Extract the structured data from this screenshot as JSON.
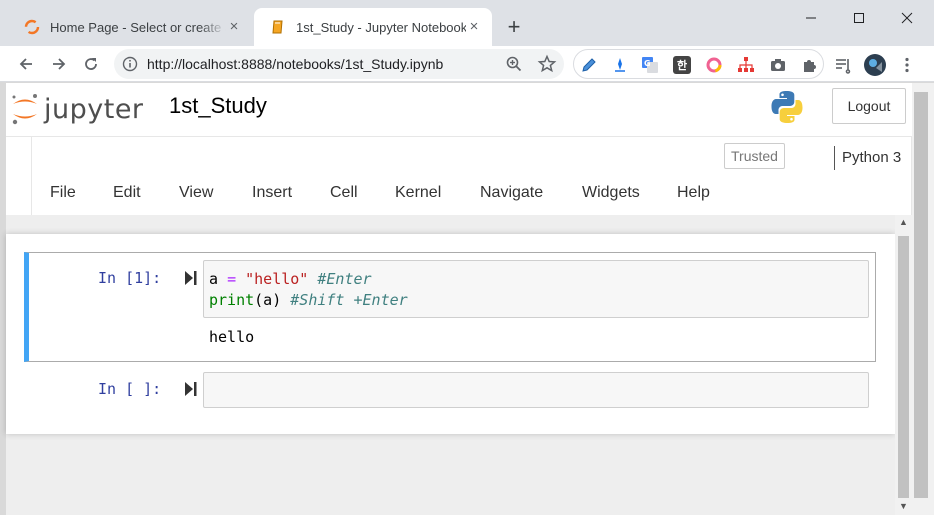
{
  "browser": {
    "tabs": [
      {
        "title": "Home Page - Select or create a notebook",
        "active": false,
        "favicon": "jupyter-icon"
      },
      {
        "title": "1st_Study - Jupyter Notebook",
        "active": true,
        "favicon": "notebook-icon"
      }
    ],
    "close_glyph": "×",
    "new_tab_glyph": "+",
    "url": "http://localhost:8888/notebooks/1st_Study.ipynb",
    "extensions": [
      "pen-icon",
      "pin-icon",
      "translate-icon",
      "hangul-icon",
      "circle-icon",
      "sitemap-icon",
      "camera-icon",
      "puzzle-icon"
    ],
    "hangul_glyph": "한"
  },
  "jupyter": {
    "logo_text": "jupyter",
    "notebook_title": "1st_Study",
    "logout_label": "Logout",
    "trusted_label": "Trusted",
    "kernel_name": "Python 3",
    "menu": [
      "File",
      "Edit",
      "View",
      "Insert",
      "Cell",
      "Kernel",
      "Navigate",
      "Widgets",
      "Help"
    ]
  },
  "cells": [
    {
      "prompt": "In [1]:",
      "code_lines": [
        [
          {
            "t": "a ",
            "c": ""
          },
          {
            "t": "=",
            "c": "op"
          },
          {
            "t": " ",
            "c": ""
          },
          {
            "t": "\"hello\"",
            "c": "str"
          },
          {
            "t": " ",
            "c": ""
          },
          {
            "t": "#Enter",
            "c": "cm"
          }
        ],
        [
          {
            "t": "print",
            "c": "kw"
          },
          {
            "t": "(a) ",
            "c": ""
          },
          {
            "t": "#Shift +Enter",
            "c": "cm"
          }
        ]
      ],
      "output": "hello"
    },
    {
      "prompt": "In [ ]:",
      "code_lines": [],
      "output": ""
    }
  ],
  "colors": {
    "selected_cell_border": "#42a5f5",
    "prompt_in": "#303f9f",
    "jupyter_orange": "#f37726"
  }
}
